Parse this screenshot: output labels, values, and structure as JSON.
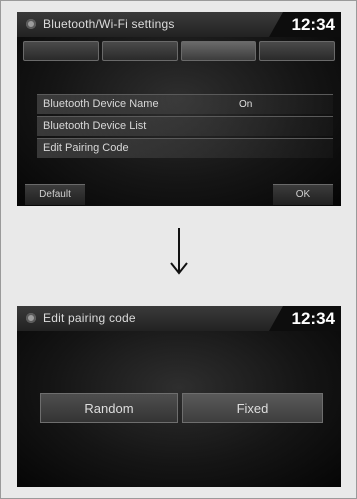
{
  "top_screen": {
    "title": "Bluetooth/Wi-Fi settings",
    "clock": "12:34",
    "tabs": [
      "",
      "",
      "",
      ""
    ],
    "rows": [
      {
        "label": "Bluetooth Device Name",
        "value": "On"
      },
      {
        "label": "Bluetooth Device List",
        "value": ""
      },
      {
        "label": "Edit Pairing Code",
        "value": ""
      }
    ],
    "softkeys": {
      "left": "Default",
      "right": "OK"
    }
  },
  "bottom_screen": {
    "title": "Edit pairing code",
    "clock": "12:34",
    "buttons": {
      "random": "Random",
      "fixed": "Fixed"
    }
  },
  "icons": {
    "title_icon": "settings-dot-icon",
    "transition": "down-arrow-icon"
  },
  "colors": {
    "screen_bg": "#111111",
    "button_bg": "#444444",
    "text": "#dedede"
  }
}
